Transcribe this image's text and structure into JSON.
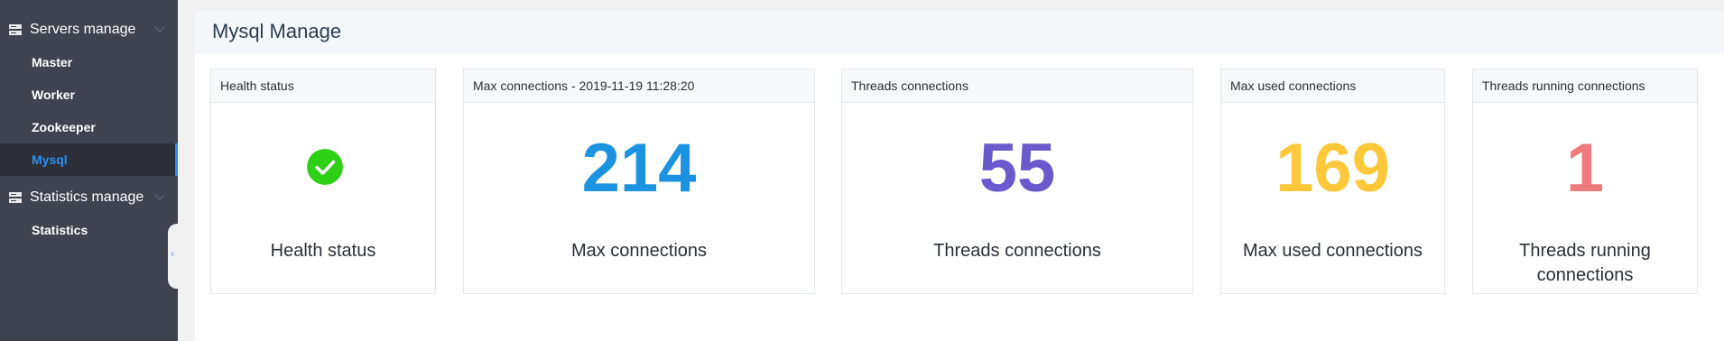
{
  "sidebar": {
    "groups": [
      {
        "label": "Servers manage",
        "icon": "server-icon",
        "items": [
          {
            "label": "Master",
            "active": false
          },
          {
            "label": "Worker",
            "active": false
          },
          {
            "label": "Zookeeper",
            "active": false
          },
          {
            "label": "Mysql",
            "active": true
          }
        ]
      },
      {
        "label": "Statistics manage",
        "icon": "server-icon",
        "items": [
          {
            "label": "Statistics",
            "active": false
          }
        ]
      }
    ],
    "collapse_icon": "chevron-left-icon"
  },
  "main": {
    "title": "Mysql Manage",
    "cards": [
      {
        "header": "Health status",
        "label": "Health status",
        "status_icon": "check-circle-icon",
        "color": "#2ed016"
      },
      {
        "header": "Max connections - 2019-11-19 11:28:20",
        "value": "214",
        "label": "Max connections",
        "color": "#1c93e0"
      },
      {
        "header": "Threads connections",
        "value": "55",
        "label": "Threads connections",
        "color": "#6a5acd"
      },
      {
        "header": "Max used connections",
        "value": "169",
        "label": "Max used connections",
        "color": "#fdc83a"
      },
      {
        "header": "Threads running connections",
        "value": "1",
        "label": "Threads running connections",
        "color": "#f07b7c"
      }
    ]
  },
  "colors": {
    "sidebar_bg": "#3f434f",
    "active_item": "#2d8cf0"
  }
}
